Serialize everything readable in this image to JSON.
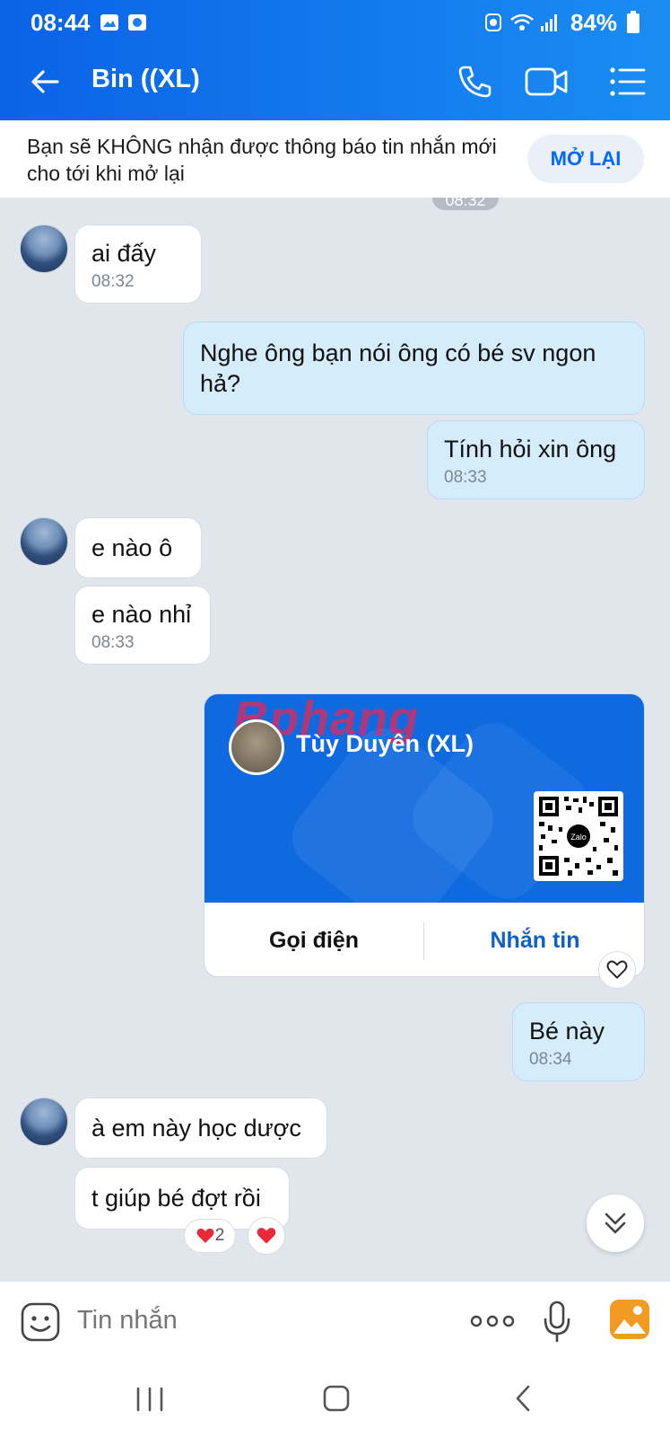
{
  "status_bar": {
    "time": "08:44",
    "battery": "84%"
  },
  "header": {
    "title": "Bin ((XL)"
  },
  "notice": {
    "text": "Bạn sẽ KHÔNG nhận được thông báo tin nhắn mới cho tới khi mở lại",
    "button": "MỞ LẠI"
  },
  "chat": {
    "top_stamp": "08:32",
    "messages": [
      {
        "dir": "in",
        "text": "ai đấy",
        "time": "08:32"
      },
      {
        "dir": "out",
        "text": "Nghe ông bạn nói ông có bé sv ngon hả?"
      },
      {
        "dir": "out",
        "text": "Tính hỏi xin ông",
        "time": "08:33"
      },
      {
        "dir": "in",
        "text": "e nào ô"
      },
      {
        "dir": "in",
        "text": "e nào nhỉ",
        "time": "08:33"
      },
      {
        "dir": "out",
        "text": "Bé này",
        "time": "08:34"
      },
      {
        "dir": "in",
        "text": "à em này học dược"
      },
      {
        "dir": "in",
        "text": "t giúp bé đợt rồi"
      }
    ],
    "card": {
      "name": "Tùy Duyên (XL)",
      "watermark": "Bphang",
      "qr_logo": "Zalo",
      "call_label": "Gọi điện",
      "message_label": "Nhắn tin"
    },
    "reaction_count": "2"
  },
  "input": {
    "placeholder": "Tin nhắn"
  },
  "colors": {
    "accent": "#0a63e6",
    "card_blue": "#0f6ae0",
    "out_bubble": "#d5ecfd",
    "background": "#e1e6ed"
  },
  "icons": [
    "back-arrow-icon",
    "phone-icon",
    "video-call-icon",
    "menu-list-icon",
    "sticker-icon",
    "more-dots-icon",
    "microphone-icon",
    "image-gallery-icon",
    "heart-icon",
    "chevron-double-down-icon"
  ]
}
